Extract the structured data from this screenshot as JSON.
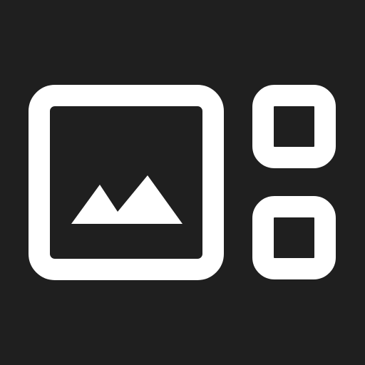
{
  "icon": {
    "name": "image-gallery-icon",
    "background_color": "#1f1f1f",
    "stroke_color": "#ffffff"
  }
}
